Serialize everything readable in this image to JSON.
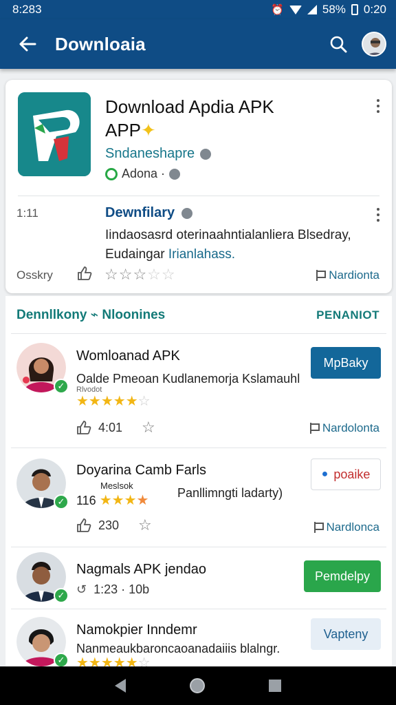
{
  "status": {
    "time": "8:283",
    "battery_pct": "58%",
    "clock": "0:20"
  },
  "appbar": {
    "title": "Downloaia"
  },
  "app": {
    "title_line1": "Download Apdia APK",
    "title_line2": "APP",
    "developer": "Sndaneshapre",
    "meta": "Adona ·"
  },
  "update": {
    "time": "1:11",
    "title": "Dewnfilary",
    "desc_part1": "Iindaosasrd oterinaahntialanliera Blsedray,",
    "desc_part2": "Eudaingar",
    "desc_highlight": "Irianlahass."
  },
  "card_footer": {
    "left_label": "Osskry",
    "report_label": "Nardionta"
  },
  "section": {
    "heading": "Dennllkony ⌁ Nloonines",
    "action": "PENANIOT"
  },
  "items": [
    {
      "title": "Womloanad APK",
      "subtitle": "Oalde Pmeoan Kudlanemorja Kslamauhl",
      "tiny": "Rlvodot",
      "rating": 4.5,
      "stat": "4:01",
      "button": "MpBaky",
      "report": "Nardolonta"
    },
    {
      "title": "Doyarina Camb Farls",
      "small_label": "Meslsok",
      "count": "116",
      "right_text": "Panllimngti ladarty)",
      "rating": 3.5,
      "stat": "230",
      "button": "poaike",
      "report": "Nardlonca"
    },
    {
      "title": "Nagmals APK jendao",
      "stat": "1:23 · 10b",
      "button": "Pemdelpy"
    },
    {
      "title": "Namokpier Inndemr",
      "subtitle": "Nanmeaukbaroncaoanadaiiis blalngr.",
      "rating": 4.5,
      "button": "Vapteny"
    }
  ],
  "colors": {
    "appbar": "#0f4c85",
    "accent_teal": "#137a78",
    "button_blue": "#13679a",
    "button_green": "#2aa64b",
    "star_gold": "#f2b614"
  }
}
